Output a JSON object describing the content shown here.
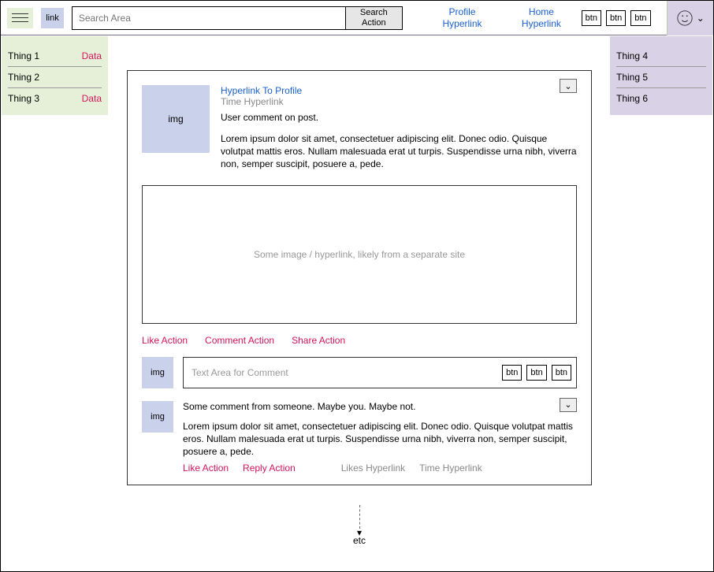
{
  "header": {
    "link_label": "link",
    "search_placeholder": "Search Area",
    "search_button": "Search Action",
    "nav": {
      "profile": "Profile Hyperlink",
      "home": "Home Hyperlink"
    },
    "btns": [
      "btn",
      "btn",
      "btn"
    ]
  },
  "left_sidebar": [
    {
      "label": "Thing 1",
      "data": "Data"
    },
    {
      "label": "Thing 2",
      "data": ""
    },
    {
      "label": "Thing 3",
      "data": "Data"
    }
  ],
  "right_sidebar": [
    {
      "label": "Thing 4"
    },
    {
      "label": "Thing 5"
    },
    {
      "label": "Thing 6"
    }
  ],
  "post": {
    "avatar": "img",
    "profile_link": "Hyperlink To Profile",
    "time_link": "Time Hyperlink",
    "comment": "User comment on post.",
    "lorem": "Lorem ipsum dolor sit amet, consectetuer adipiscing elit. Donec odio. Quisque volutpat mattis eros. Nullam malesuada erat ut turpis. Suspendisse urna nibh, viverra non, semper suscipit, posuere a, pede.",
    "embed_text": "Some image / hyperlink, likely from a separate site",
    "actions": {
      "like": "Like Action",
      "comment": "Comment Action",
      "share": "Share Action"
    },
    "comment_input": {
      "avatar": "img",
      "placeholder": "Text Area for Comment",
      "btns": [
        "btn",
        "btn",
        "btn"
      ]
    },
    "reply": {
      "avatar": "img",
      "text_intro": "Some comment from someone. Maybe you. Maybe not.",
      "lorem": "Lorem ipsum dolor sit amet, consectetuer adipiscing elit. Donec odio. Quisque volutpat mattis eros. Nullam malesuada erat ut turpis. Suspendisse urna nibh, viverra non, semper suscipit, posuere a, pede.",
      "like": "Like Action",
      "reply_action": "Reply Action",
      "likes_link": "Likes Hyperlink",
      "time_link": "Time Hyperlink"
    }
  },
  "footer_etc": "etc"
}
